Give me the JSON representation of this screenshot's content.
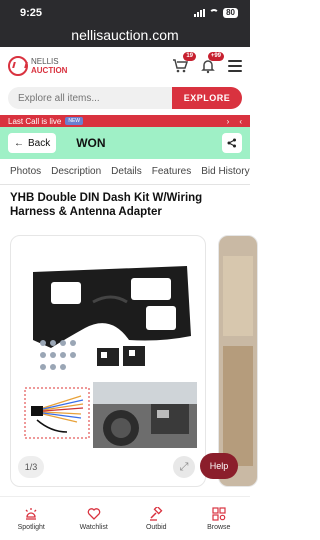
{
  "status_bar": {
    "time": "9:25",
    "battery": "80"
  },
  "url_bar": {
    "url": "nellisauction.com"
  },
  "header": {
    "logo_line1": "NELLIS",
    "logo_line2": "AUCTION",
    "cart_badge": "19",
    "notifications_badge": "+99"
  },
  "search": {
    "placeholder": "Explore all items...",
    "button_label": "EXPLORE"
  },
  "banner": {
    "text": "Last Call is live",
    "tag": "NEW"
  },
  "status_bar_won": {
    "back_label": "Back",
    "status": "WON"
  },
  "tabs": [
    "Photos",
    "Description",
    "Details",
    "Features",
    "Bid History"
  ],
  "product": {
    "title": "YHB Double DIN Dash Kit W/Wiring Harness & Antenna Adapter"
  },
  "gallery": {
    "counter": "1/3"
  },
  "help": {
    "label": "Help"
  },
  "bottom_nav": [
    {
      "label": "Spotlight",
      "icon": "spotlight-icon"
    },
    {
      "label": "Watchlist",
      "icon": "heart-icon"
    },
    {
      "label": "Outbid",
      "icon": "gavel-icon"
    },
    {
      "label": "Browse",
      "icon": "browse-icon"
    }
  ],
  "colors": {
    "brand_red": "#d9323f",
    "won_green": "#9ff0c6",
    "help_bg": "#8b1e2b"
  }
}
